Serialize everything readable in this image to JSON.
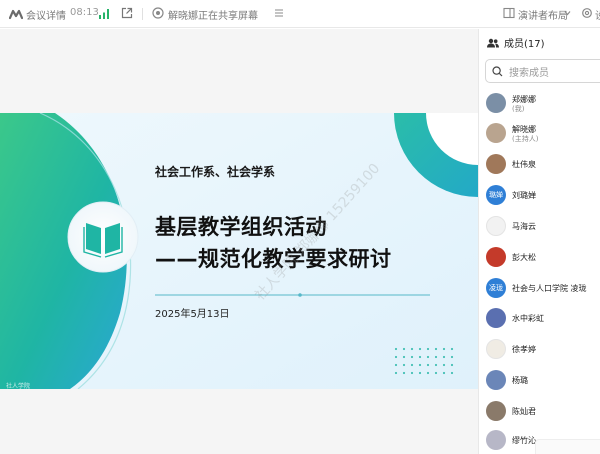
{
  "topbar": {
    "meeting_label": "会议详情",
    "time": "08:13",
    "share_label": "解晓娜正在共享屏幕",
    "layout_label": "演讲者布局",
    "gear_label": "设"
  },
  "slide": {
    "subtitle": "社会工作系、社会学系",
    "title_line1": "基层教学组织活动",
    "title_line2": "——规范化教学要求研讨",
    "date": "2025年5月13日",
    "watermark_1": "社人学院 郑娜娜 15259100",
    "watermark_2": "社人学院 郑娜娜 15259100",
    "footer_text": "社人学院",
    "accent_color": "#1fb5a4",
    "secondary_color": "#2aa7d4"
  },
  "members": {
    "title": "成员(17)",
    "search_placeholder": "搜索成员",
    "list": [
      {
        "name": "郑娜娜",
        "role": "(我)",
        "avatar_color": "#7b8fa6",
        "avatar_text": ""
      },
      {
        "name": "解晓娜",
        "role": "(主持人)",
        "avatar_color": "#b9a48f",
        "avatar_text": ""
      },
      {
        "name": "杜伟泉",
        "role": "",
        "avatar_color": "#a0785a",
        "avatar_text": ""
      },
      {
        "name": "刘璐婵",
        "role": "",
        "avatar_color": "#2f7fd6",
        "avatar_text": "璐婵"
      },
      {
        "name": "马海云",
        "role": "",
        "avatar_color": "#f2f2f2",
        "avatar_text": ""
      },
      {
        "name": "彭大松",
        "role": "",
        "avatar_color": "#c43a2a",
        "avatar_text": ""
      },
      {
        "name": "社会与人口学院  凌珑",
        "role": "",
        "avatar_color": "#2f7fd6",
        "avatar_text": "凌珑"
      },
      {
        "name": "水中彩虹",
        "role": "",
        "avatar_color": "#5a6fb0",
        "avatar_text": ""
      },
      {
        "name": "徐孝婷",
        "role": "",
        "avatar_color": "#f0ece4",
        "avatar_text": ""
      },
      {
        "name": "杨璐",
        "role": "",
        "avatar_color": "#6b86b8",
        "avatar_text": ""
      },
      {
        "name": "陈灿君",
        "role": "",
        "avatar_color": "#8a7a6a",
        "avatar_text": ""
      },
      {
        "name": "缪竹沁",
        "role": "",
        "avatar_color": "#b7b7c7",
        "avatar_text": ""
      }
    ]
  }
}
